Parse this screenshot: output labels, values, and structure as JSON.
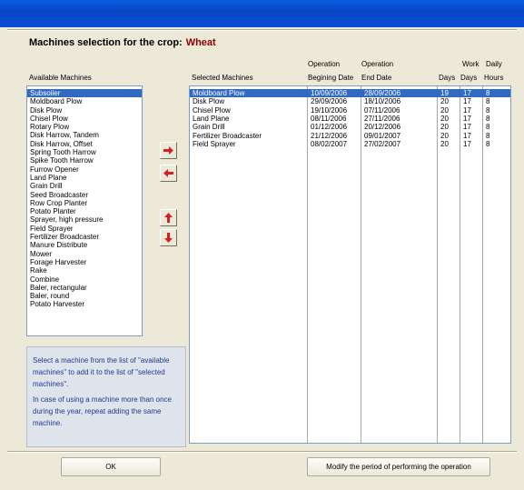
{
  "heading": {
    "label": "Machines selection for the crop:",
    "crop": "Wheat"
  },
  "available": {
    "label": "Available Machines",
    "selected_index": 0,
    "items": [
      "Subsoiler",
      "Moldboard Plow",
      "Disk Plow",
      "Chisel Plow",
      "Rotary Plow",
      "Disk Harrow, Tandem",
      "Disk Harrow, Offset",
      "Spring Tooth Harrow",
      "Spike Tooth Harrow",
      "Furrow Opener",
      "Land Plane",
      "Grain Drill",
      "Seed Broadcaster",
      "Row Crop Planter",
      "Potato Planter",
      "Sprayer, high pressure",
      "Field Sprayer",
      "Fertilizer Broadcaster",
      "Manure Distribute",
      "Mower",
      "Forage Harvester",
      "Rake",
      "Combine",
      "Baler, rectangular",
      "Baler, round",
      "Potato Harvester"
    ]
  },
  "selected": {
    "headers": {
      "machines": "Selected Machines",
      "op1": "Operation",
      "begin": "Begining Date",
      "op2": "Operation",
      "end": "End Date",
      "days": "Days",
      "work1": "Work",
      "work2": "Days",
      "daily1": "Daily",
      "daily2": "Hours"
    },
    "selected_index": 0,
    "rows": [
      {
        "machine": "Moldboard Plow",
        "begin": "10/09/2006",
        "end": "28/09/2006",
        "days": "19",
        "work": "17",
        "hours": "8"
      },
      {
        "machine": "Disk Plow",
        "begin": "29/09/2006",
        "end": "18/10/2006",
        "days": "20",
        "work": "17",
        "hours": "8"
      },
      {
        "machine": "Chisel Plow",
        "begin": "19/10/2006",
        "end": "07/11/2006",
        "days": "20",
        "work": "17",
        "hours": "8"
      },
      {
        "machine": "Land Plane",
        "begin": "08/11/2006",
        "end": "27/11/2006",
        "days": "20",
        "work": "17",
        "hours": "8"
      },
      {
        "machine": "Grain Drill",
        "begin": "01/12/2006",
        "end": "20/12/2006",
        "days": "20",
        "work": "17",
        "hours": "8"
      },
      {
        "machine": "Fertilizer Broadcaster",
        "begin": "21/12/2006",
        "end": "09/01/2007",
        "days": "20",
        "work": "17",
        "hours": "8"
      },
      {
        "machine": "Field Sprayer",
        "begin": "08/02/2007",
        "end": "27/02/2007",
        "days": "20",
        "work": "17",
        "hours": "8"
      }
    ]
  },
  "arrows": [
    {
      "name": "add-right-arrow-icon",
      "direction": "right"
    },
    {
      "name": "remove-left-arrow-icon",
      "direction": "left"
    },
    {
      "name": "move-up-arrow-icon",
      "direction": "up"
    },
    {
      "name": "move-down-arrow-icon",
      "direction": "down"
    }
  ],
  "help": {
    "p1": "Select a machine from the list of \"available machines\" to add it to the list of \"selected machines\".",
    "p2": "In case of using a machine more than once during the year, repeat adding the same machine."
  },
  "buttons": {
    "ok": "OK",
    "modify": "Modify the period of performing the operation"
  },
  "colors": {
    "titlebar": "#0a4cd6",
    "selection": "#316ac5",
    "crop": "#8b0000",
    "arrow": "#d62020",
    "help_text": "#1f3b94"
  }
}
